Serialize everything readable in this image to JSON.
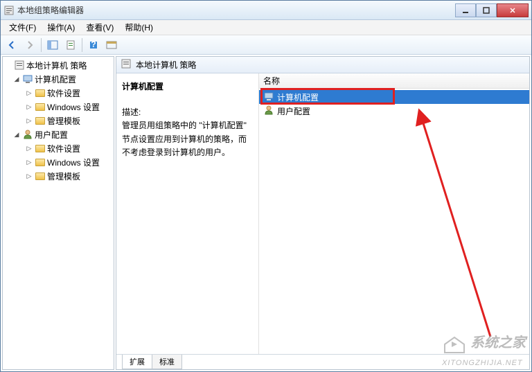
{
  "window": {
    "title": "本地组策略编辑器"
  },
  "menu": {
    "file": "文件(F)",
    "action": "操作(A)",
    "view": "查看(V)",
    "help": "帮助(H)"
  },
  "tree": {
    "root": "本地计算机 策略",
    "computer": "计算机配置",
    "user": "用户配置",
    "software": "软件设置",
    "windows": "Windows 设置",
    "templates": "管理模板"
  },
  "right": {
    "header": "本地计算机 策略",
    "section": "计算机配置",
    "desc_label": "描述:",
    "desc_text": "管理员用组策略中的 \"计算机配置\" 节点设置应用到计算机的策略，而不考虑登录到计算机的用户。",
    "col_name": "名称",
    "item_computer": "计算机配置",
    "item_user": "用户配置"
  },
  "tabs": {
    "extended": "扩展",
    "standard": "标准"
  },
  "watermark": {
    "cn": "系统之家",
    "url": "XITONGZHIJIA.NET"
  }
}
